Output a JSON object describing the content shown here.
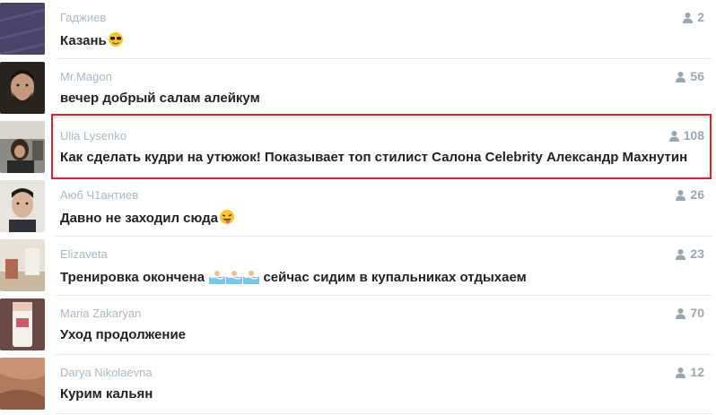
{
  "feed": {
    "items": [
      {
        "author": "Гаджиев",
        "title": "Казань",
        "viewers": "2"
      },
      {
        "author": "Mr.Magon",
        "title": "вечер добрый салам алейкум",
        "viewers": "56"
      },
      {
        "author": "Ulia Lysenko",
        "title": "Как сделать кудри на утюжок! Показывает топ стилист Салона Celebrity Александр Махнутин",
        "viewers": "108"
      },
      {
        "author": "Аюб Ч1антиев",
        "title": "Давно не заходил сюда",
        "viewers": "26"
      },
      {
        "author": "Elizaveta",
        "title_before": "Тренировка окончена",
        "title_after": "сейчас сидим в купальниках отдыхаем",
        "viewers": "23"
      },
      {
        "author": "Maria Zakaryan",
        "title": "Уход продолжение",
        "viewers": "70"
      },
      {
        "author": "Darya Nikolaevna",
        "title": "Курим кальян",
        "viewers": "12"
      }
    ]
  },
  "icons": {
    "viewer": "person-icon",
    "emoji_sunglasses": "smiling-face-with-sunglasses",
    "emoji_tongue": "winking-face-with-tongue",
    "emoji_swimmer": "person-swimming"
  },
  "colors": {
    "highlight_border": "#d8262b",
    "author_text": "#a9b8c5",
    "count_text": "#9aa7b1"
  }
}
